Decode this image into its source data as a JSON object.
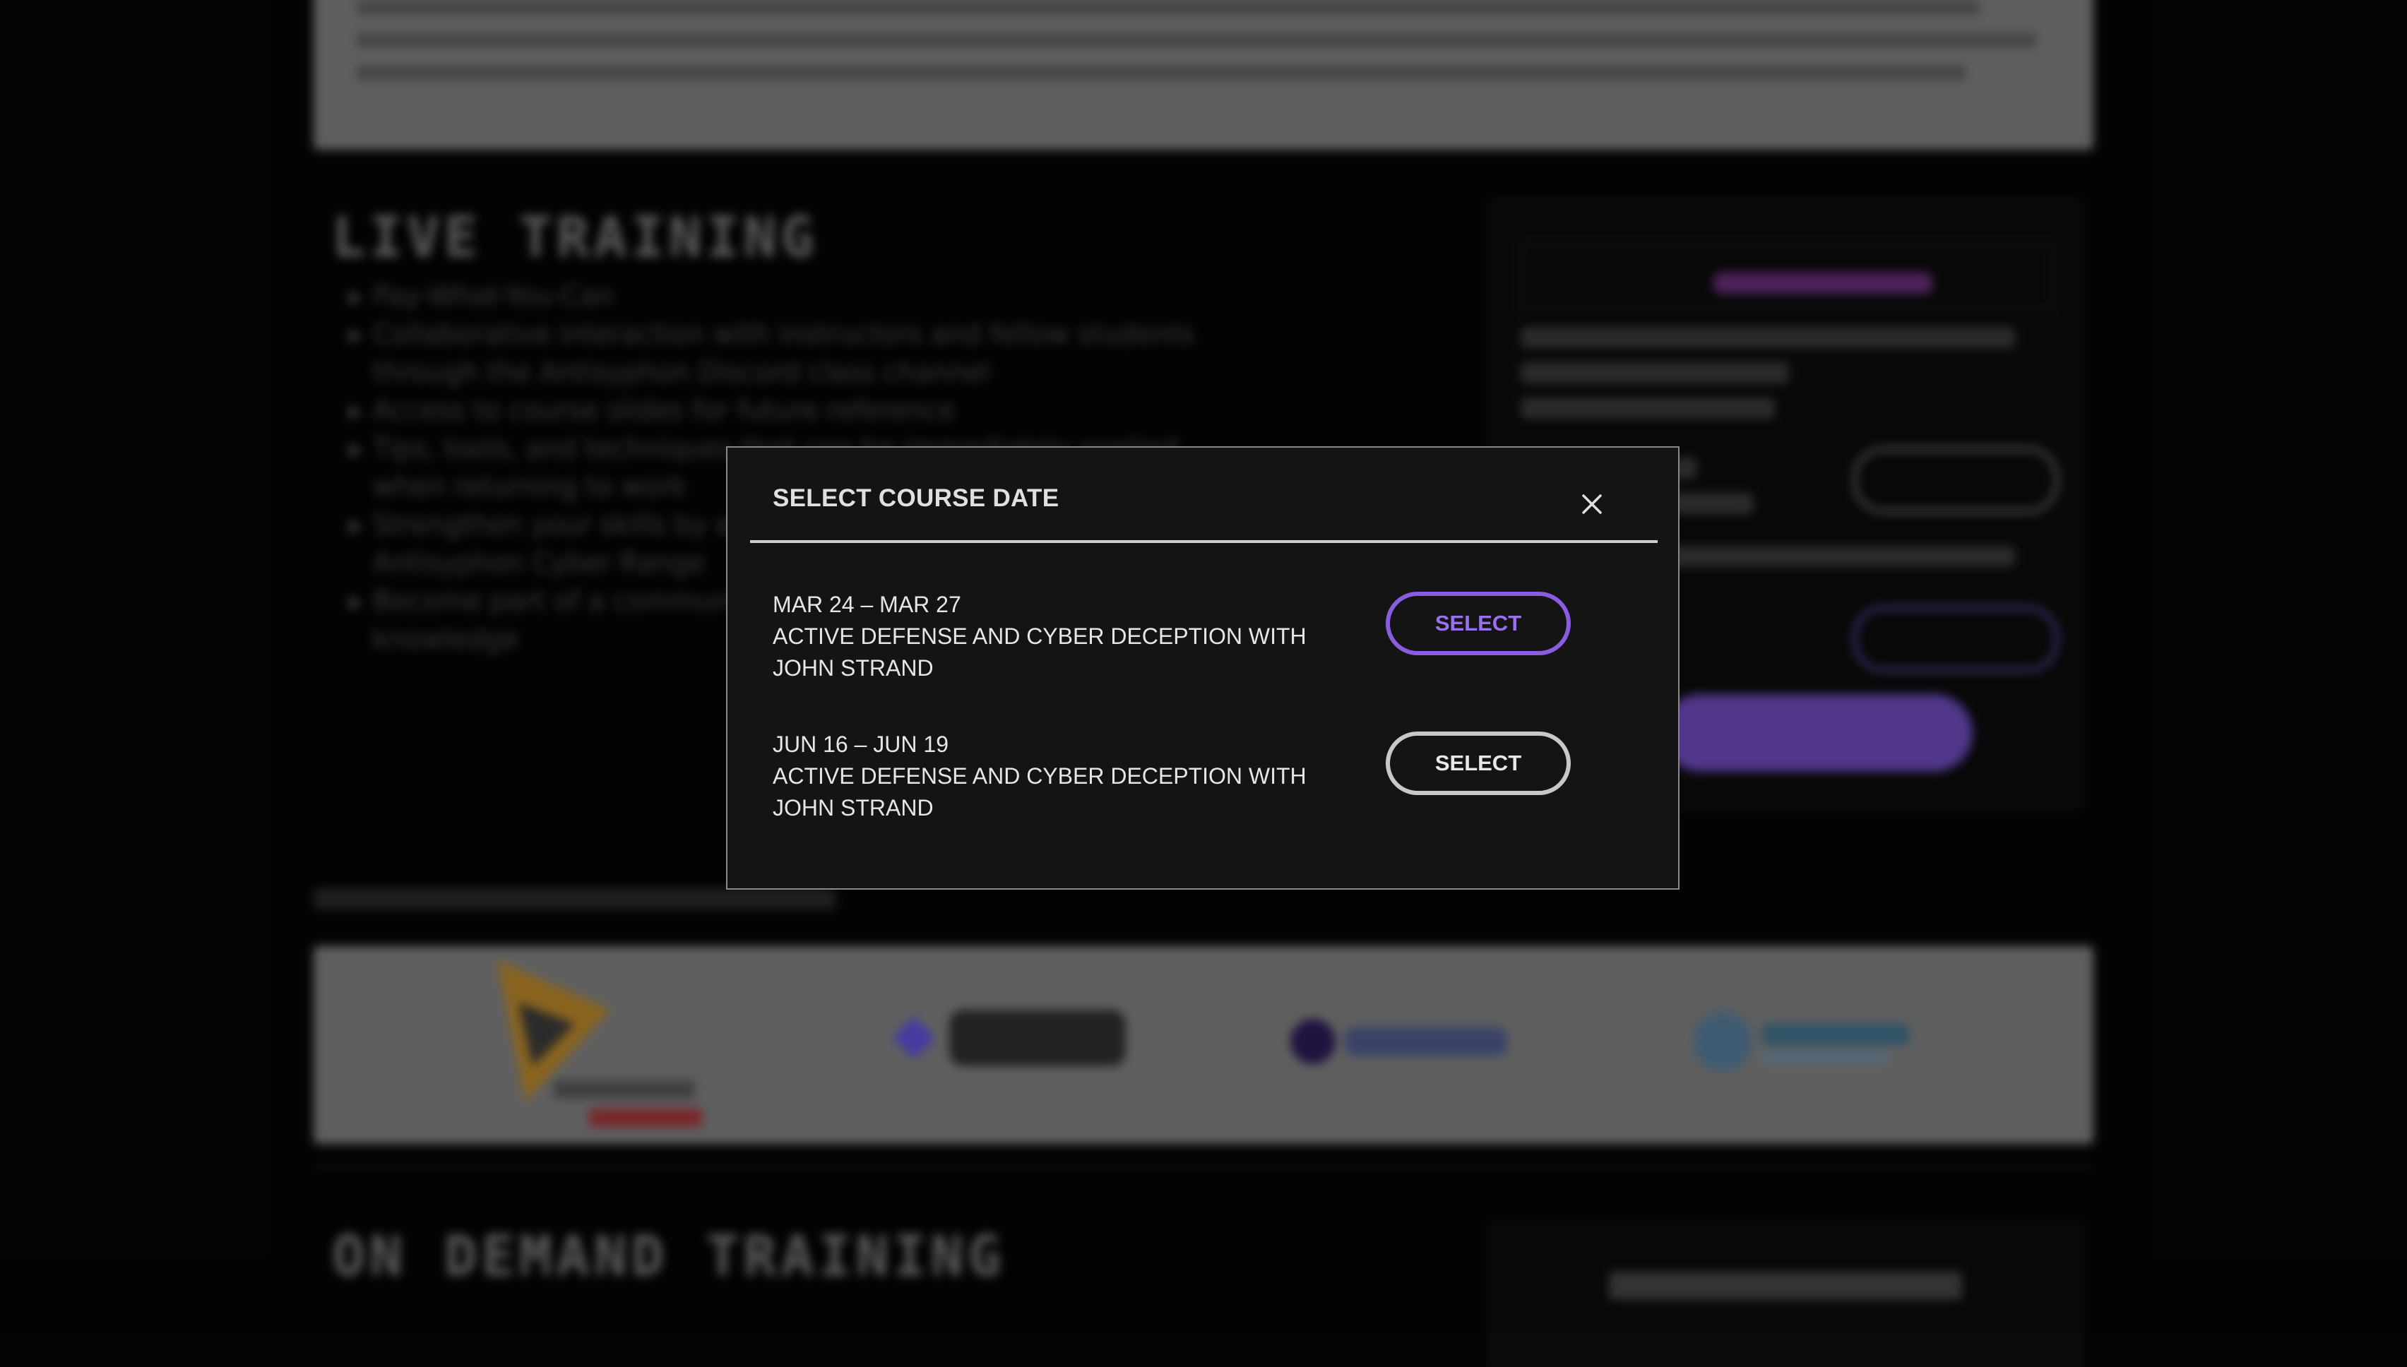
{
  "background": {
    "live_heading": "LIVE TRAINING",
    "live_bullets": [
      "Pay-What-You-Can",
      "Collaborative interaction with instructors and fellow students through the Antisyphon Discord class channel",
      "Access to course slides for future reference",
      "Tips, tools, and techniques that can be immediately applied when returning to work",
      "Strengthen your skills by earning badges through the Antisyphon Cyber Range",
      "Become part of a community of learners eager to share their knowledge"
    ],
    "ondemand_heading": "ON DEMAND TRAINING",
    "colors": {
      "intro_panel": "#7f7f7f",
      "card_cta": "#6c49b8"
    },
    "sponsor_logos": [
      "proofpoint-by-netwrix-logo",
      "flare-logo",
      "plextrac-logo",
      "trustcode-logo"
    ]
  },
  "modal": {
    "title": "SELECT COURSE DATE",
    "close_icon": "close-icon",
    "options": [
      {
        "date": "MAR 24 – MAR 27",
        "course": "ACTIVE DEFENSE AND CYBER DECEPTION WITH JOHN STRAND",
        "button": "SELECT",
        "state": "highlighted"
      },
      {
        "date": "JUN 16 – JUN 19",
        "course": "ACTIVE DEFENSE AND CYBER DECEPTION WITH JOHN STRAND",
        "button": "SELECT",
        "state": "normal"
      }
    ],
    "colors": {
      "accent": "#8a5ce0",
      "surface": "#141414",
      "border": "#8a8a8a"
    }
  }
}
